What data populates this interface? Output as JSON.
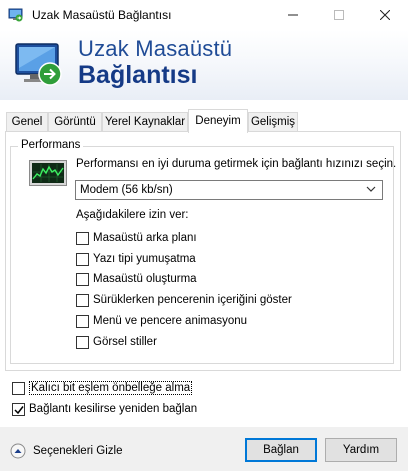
{
  "window": {
    "title": "Uzak Masaüstü Bağlantısı",
    "accent": "#0078d7"
  },
  "banner": {
    "line1": "Uzak Masaüstü",
    "line2": "Bağlantısı",
    "colors": {
      "line1": "#1f4b96",
      "line2": "#153a86"
    }
  },
  "tabs": [
    {
      "label": "Genel",
      "active": false
    },
    {
      "label": "Görüntü",
      "active": false
    },
    {
      "label": "Yerel Kaynaklar",
      "active": false
    },
    {
      "label": "Deneyim",
      "active": true
    },
    {
      "label": "Gelişmiş",
      "active": false
    }
  ],
  "performance": {
    "group_label": "Performans",
    "description": "Performansı en iyi duruma getirmek için bağlantı hızınızı seçin.",
    "speed_select": {
      "value": "Modem (56 kb/sn)"
    },
    "allow_label": "Aşağıdakilere izin ver:",
    "options": [
      {
        "label": "Masaüstü arka planı",
        "checked": false
      },
      {
        "label": "Yazı tipi yumuşatma",
        "checked": false
      },
      {
        "label": "Masaüstü oluşturma",
        "checked": false
      },
      {
        "label": "Sürüklerken pencerenin içeriğini göster",
        "checked": false
      },
      {
        "label": "Menü ve pencere animasyonu",
        "checked": false
      },
      {
        "label": "Görsel stiller",
        "checked": false
      }
    ]
  },
  "persistent_cache": {
    "label": "Kalıcı bit eşlem önbelleğe alma",
    "checked": false
  },
  "reconnect": {
    "label": "Bağlantı kesilirse yeniden bağlan",
    "checked": true
  },
  "footer": {
    "options_toggle": "Seçenekleri Gizle",
    "connect": "Bağlan",
    "cancel": "Yardım"
  }
}
